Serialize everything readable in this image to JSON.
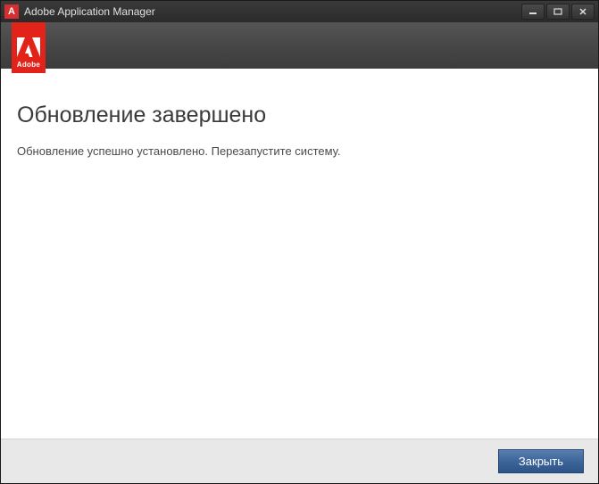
{
  "titlebar": {
    "app_icon_letter": "A",
    "title": "Adobe Application Manager"
  },
  "header": {
    "logo_text": "Adobe"
  },
  "content": {
    "heading": "Обновление завершено",
    "message": "Обновление успешно установлено. Перезапустите систему."
  },
  "footer": {
    "close_label": "Закрыть"
  }
}
